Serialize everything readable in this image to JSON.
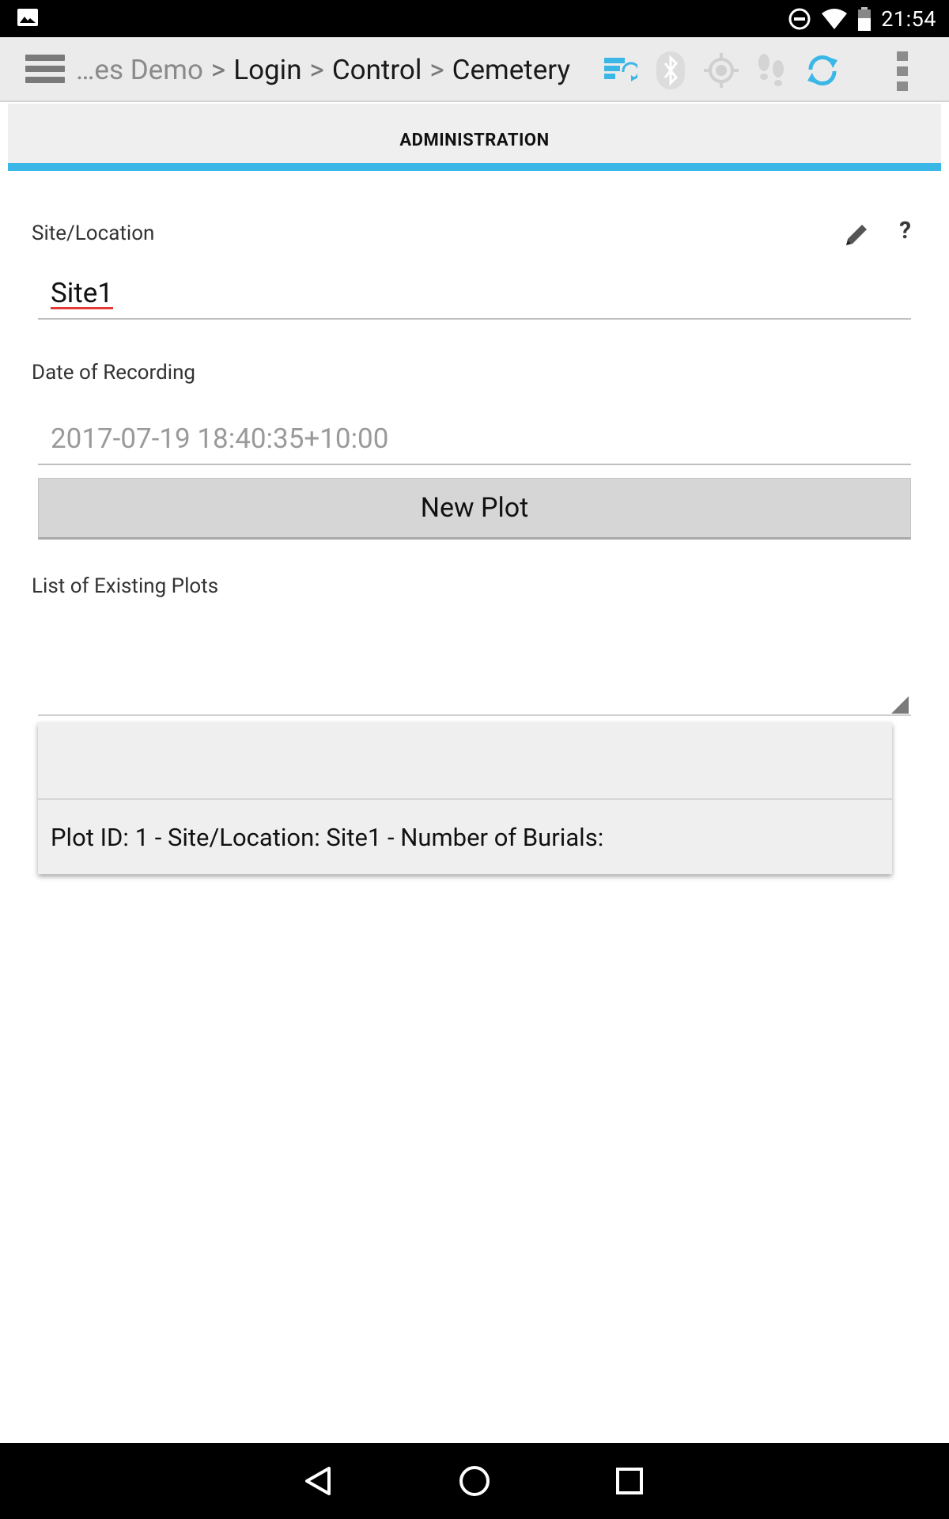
{
  "status_bar": {
    "time": "21:54"
  },
  "toolbar": {
    "breadcrumb_dim": "…es Demo",
    "separator": ">",
    "crumbs": [
      "Login",
      "Control",
      "Cemetery"
    ]
  },
  "tab": {
    "title": "ADMINISTRATION"
  },
  "form": {
    "site_label": "Site/Location",
    "site_value": "Site1",
    "help_symbol": "?",
    "date_label": "Date of Recording",
    "date_value": "2017-07-19 18:40:35+10:00",
    "new_plot_button": "New Plot",
    "plots_label": "List of Existing Plots",
    "plot_options": [
      "",
      "Plot ID: 1 - Site/Location: Site1 - Number of Burials:"
    ]
  },
  "colors": {
    "accent": "#3ab7e6",
    "toolbar_bg": "#ebebeb",
    "spell_error": "#e53935"
  }
}
